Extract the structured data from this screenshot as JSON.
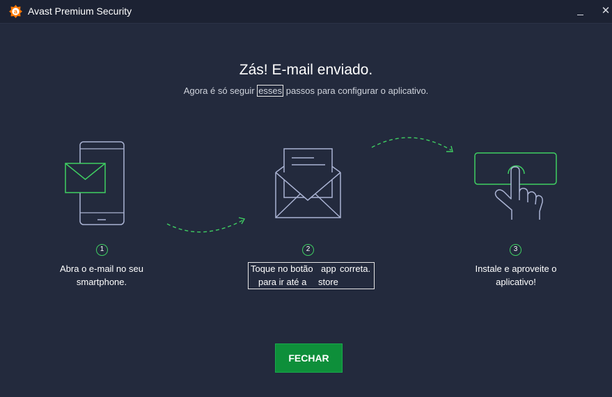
{
  "window": {
    "title": "Avast Premium Security",
    "minimize_icon": "minimize-icon",
    "close_glyph": "✕"
  },
  "main": {
    "heading": "Zás! E-mail enviado.",
    "subheading_before": "Agora é só seguir ",
    "subheading_highlight": "esses",
    "subheading_after": " passos para configurar o aplicativo."
  },
  "steps": [
    {
      "number": "1",
      "line1": "Abra o e-mail no seu",
      "line2": "smartphone.",
      "icon": "phone-email-icon"
    },
    {
      "number": "2",
      "line1_a": "Toque no botão",
      "line1_b": "app",
      "line1_c": "correta.",
      "line2_a": "para ir até a",
      "line2_b": "store",
      "icon": "open-envelope-icon"
    },
    {
      "number": "3",
      "line1": "Instale e aproveite o",
      "line2": "aplicativo!",
      "icon": "tap-button-icon"
    }
  ],
  "close_button": {
    "label": "FECHAR"
  },
  "colors": {
    "background": "#232a3d",
    "accent_green": "#3fcf62",
    "button_green": "#0e8f3a",
    "brand_orange": "#ff7800"
  }
}
